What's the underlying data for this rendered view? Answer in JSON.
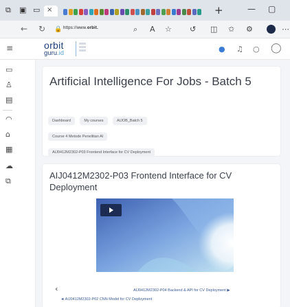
{
  "browser": {
    "tab_close": "×",
    "new_tab": "+",
    "url_prefix": "https://www.",
    "url_host": "orbit.",
    "strip_colors": [
      "#4a7bd0",
      "#e0a020",
      "#3fa34d",
      "#d8403a",
      "#8a5cc0",
      "#2fa7b8",
      "#e07020",
      "#5a8a30",
      "#c03a7a",
      "#3a66b0",
      "#b0a020",
      "#6a4ab0",
      "#2f8f6a",
      "#d05050",
      "#4a90c0",
      "#a06a30",
      "#3aa0a0",
      "#c04040",
      "#7070c0",
      "#50a050",
      "#d08030",
      "#3a7ad0",
      "#a03a90",
      "#4a8a4a",
      "#c0503a",
      "#5a6ac0",
      "#2a9a8a"
    ]
  },
  "header": {
    "logo_orbit": "orbit",
    "logo_guru_a": "guru",
    "logo_guru_b": ".id",
    "notification_color": "#3a7bd5"
  },
  "course": {
    "title": "Artificial Intelligence For Jobs - Batch 5",
    "breadcrumbs": [
      "Dashboard",
      "My courses",
      "AIJOB_Batch 5",
      "Course 4 Metode Penelitian AI",
      "AIJ0412M2302-P03 Frontend Interface for CV Deployment"
    ]
  },
  "activity": {
    "title": "AIJ0412M2302-P03 Frontend Interface for CV Deployment",
    "prev_arrow": "‹",
    "next_link": "AIJ0412M2302-P04 Backend & API for CV Deployment ▶",
    "prev_link": "◄ AIJ0412M2302-P02 CNN Model for CV Deployment"
  }
}
